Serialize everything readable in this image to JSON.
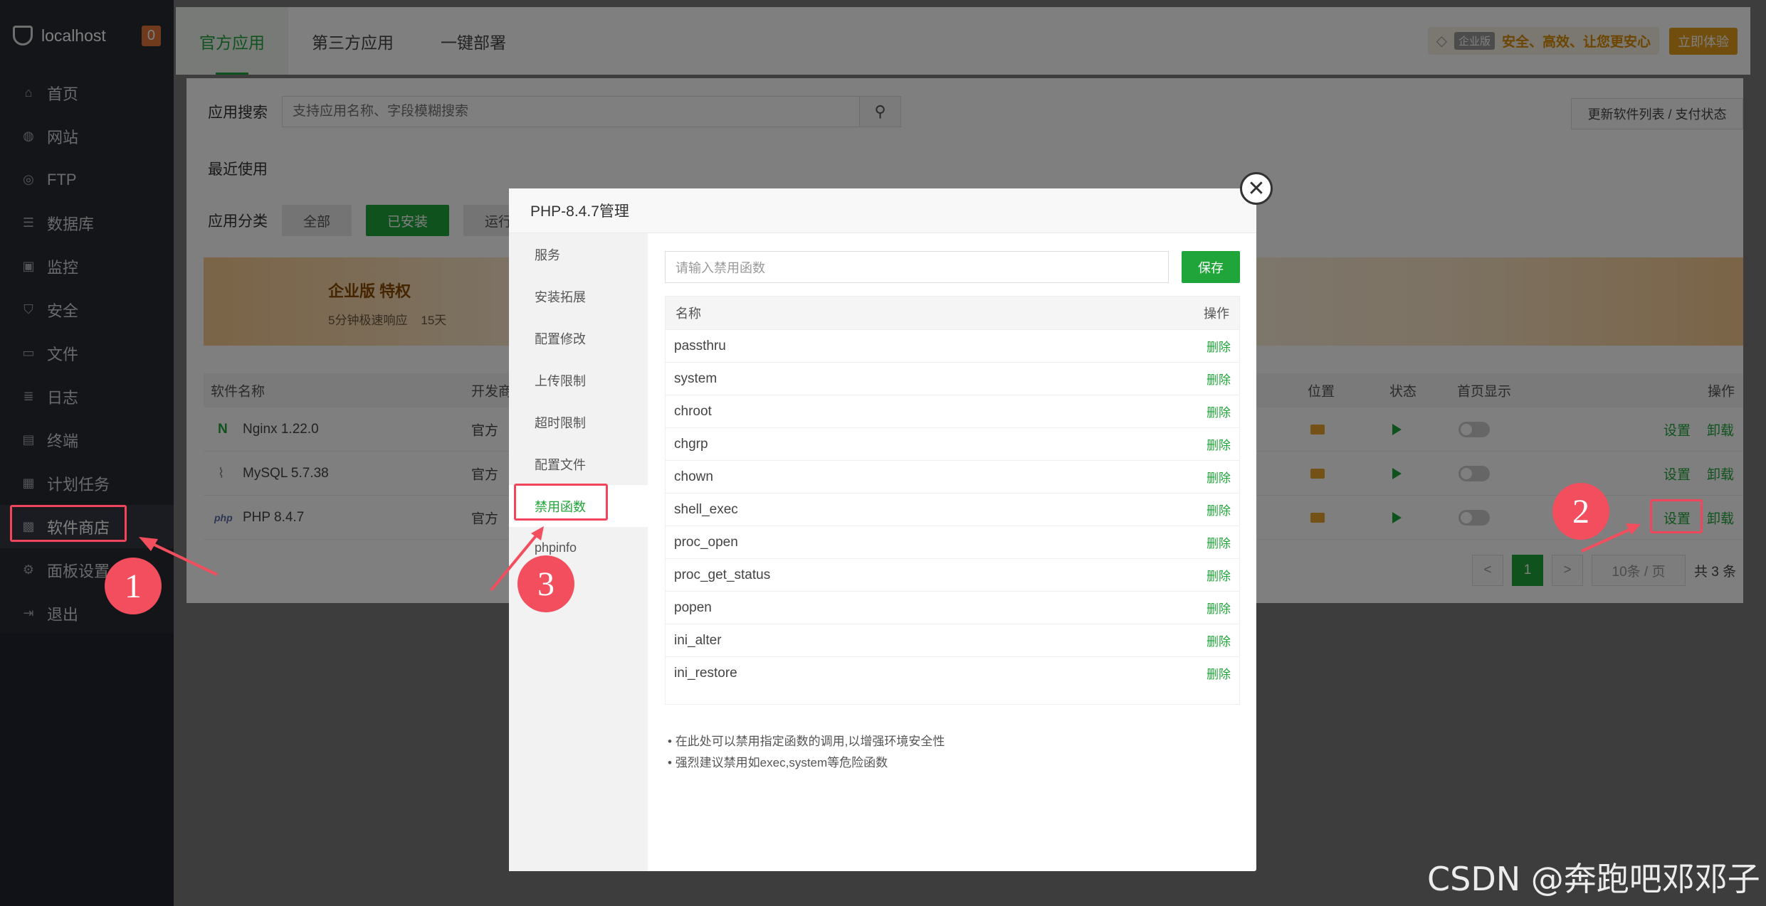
{
  "sidebar": {
    "host": "localhost",
    "badge": "0",
    "items": [
      {
        "label": "首页",
        "icon": "home-icon"
      },
      {
        "label": "网站",
        "icon": "globe-icon"
      },
      {
        "label": "FTP",
        "icon": "ftp-icon"
      },
      {
        "label": "数据库",
        "icon": "database-icon"
      },
      {
        "label": "监控",
        "icon": "monitor-icon"
      },
      {
        "label": "安全",
        "icon": "shield-icon"
      },
      {
        "label": "文件",
        "icon": "folder-icon"
      },
      {
        "label": "日志",
        "icon": "log-icon"
      },
      {
        "label": "终端",
        "icon": "terminal-icon"
      },
      {
        "label": "计划任务",
        "icon": "calendar-icon"
      },
      {
        "label": "软件商店",
        "icon": "grid-icon"
      },
      {
        "label": "面板设置",
        "icon": "gear-icon"
      },
      {
        "label": "退出",
        "icon": "logout-icon"
      }
    ]
  },
  "topbar": {
    "tabs": [
      "官方应用",
      "第三方应用",
      "一键部署"
    ],
    "edition_tag": "企业版",
    "edition_slogan": "安全、高效、让您更安心",
    "trial_button": "立即体验"
  },
  "main": {
    "search_label": "应用搜索",
    "search_placeholder": "支持应用名称、字段模糊搜索",
    "update_button": "更新软件列表 / 支付状态",
    "recent_label": "最近使用",
    "category_label": "应用分类",
    "categories": [
      "全部",
      "已安装",
      "运行"
    ],
    "banner_title": "企业版 特权",
    "banner_sub1": "5分钟极速响应",
    "banner_sub2": "15天",
    "columns": {
      "name": "软件名称",
      "dev": "开发商",
      "location": "位置",
      "status": "状态",
      "homepage": "首页显示",
      "ops": "操作"
    },
    "rows": [
      {
        "name": "Nginx 1.22.0",
        "dev": "官方",
        "set": "设置",
        "uninstall": "卸载"
      },
      {
        "name": "MySQL 5.7.38",
        "dev": "官方",
        "set": "设置",
        "uninstall": "卸载"
      },
      {
        "name": "PHP 8.4.7",
        "dev": "官方",
        "set": "设置",
        "uninstall": "卸载"
      }
    ],
    "pager": {
      "prev": "<",
      "page": "1",
      "next": ">",
      "size": "10条 / 页",
      "total": "共 3 条"
    }
  },
  "modal": {
    "title": "PHP-8.4.7管理",
    "nav": [
      "服务",
      "安装拓展",
      "配置修改",
      "上传限制",
      "超时限制",
      "配置文件",
      "禁用函数",
      "phpinfo"
    ],
    "input_placeholder": "请输入禁用函数",
    "save_button": "保存",
    "col_name": "名称",
    "col_ops": "操作",
    "functions": [
      "passthru",
      "system",
      "chroot",
      "chgrp",
      "chown",
      "shell_exec",
      "proc_open",
      "proc_get_status",
      "popen",
      "ini_alter",
      "ini_restore"
    ],
    "delete_label": "删除",
    "tips": [
      "在此处可以禁用指定函数的调用,以增强环境安全性",
      "强烈建议禁用如exec,system等危险函数"
    ]
  },
  "annotations": [
    "1",
    "2",
    "3"
  ],
  "watermark": "CSDN @奔跑吧邓邓子"
}
